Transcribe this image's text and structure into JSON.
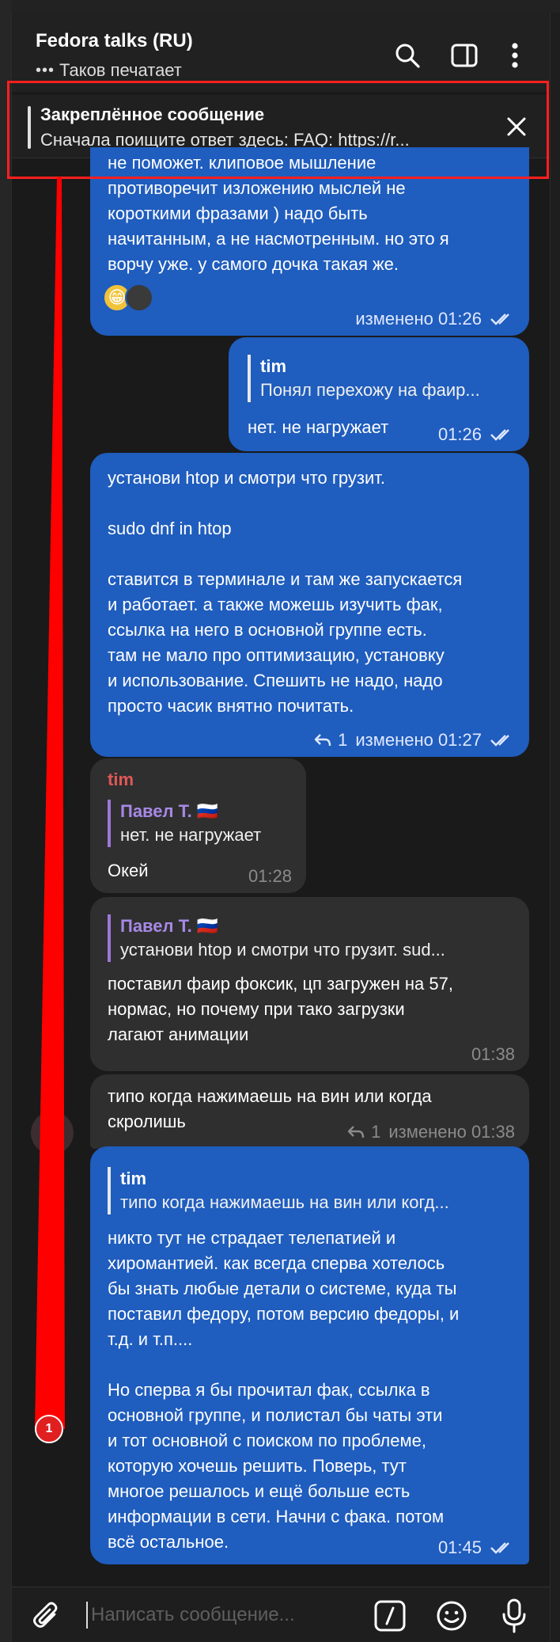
{
  "header": {
    "title": "Fedora talks (RU)",
    "status": "Таков печатает",
    "typing_indicator": "•••"
  },
  "pinned": {
    "title": "Закреплённое сообщение",
    "text": "Сначала поищите ответ здесь: FAQ: https://r..."
  },
  "messages": {
    "m1": {
      "text": "не поможет. клиповое мышление\nпротиворечит изложению мыслей не\nкороткими фразами ) надо быть\nначитанным, а не насмотренным. но это я\nворчу уже. у самого дочка такая же.",
      "reaction": "😁",
      "meta": "изменено 01:26"
    },
    "m2": {
      "quote_name": "tim",
      "quote_text": "Понял перехожу на фаир...",
      "text": "нет. не нагружает",
      "time": "01:26"
    },
    "m3": {
      "text": "установи htop и смотри что грузит.\n\nsudo dnf in htop\n\nставится в терминале и там же запускается\nи работает. а также можешь изучить фак,\nссылка на него в основной группе есть.\nтам не мало про оптимизацию, установку\nи использование. Спешить не надо, надо\nпросто часик внятно почитать.",
      "replies": "1",
      "meta": "изменено 01:27"
    },
    "m4": {
      "sender": "tim",
      "quote_name": "Павел Т. 🇷🇺",
      "quote_text": "нет. не нагружает",
      "text": "Окей",
      "time": "01:28"
    },
    "m5": {
      "quote_name": "Павел Т. 🇷🇺",
      "quote_text": "установи htop и смотри что грузит.  sud...",
      "text": "поставил фаир фоксик, цп загружен на 57,\nнормас, но почему при тако загрузки\nлагают анимации",
      "time": "01:38"
    },
    "m6": {
      "text": "типо когда нажимаешь на вин или когда\nскролишь",
      "replies": "1",
      "meta": "изменено 01:38"
    },
    "m7": {
      "quote_name": "tim",
      "quote_text": "типо когда нажимаешь на вин или когд...",
      "text": "никто тут не страдает телепатией и\nхиромантией. как всегда сперва хотелось\nбы знать любые детали о системе, куда ты\nпоставил федору, потом версию федоры, и\nт.д. и т.п....\n\nНо сперва я бы прочитал фак, ссылка в\nосновной группе, и полистал бы чаты эти\nи тот основной с поиском по проблеме,\nкоторую хочешь решить. Поверь, тут\nмногое решалось и ещё больше есть\nинформации в сети. Начни с фака. потом\nвсё остальное.",
      "time": "01:45"
    }
  },
  "unread_badge": "1",
  "composer": {
    "placeholder": "Написать сообщение..."
  },
  "colors": {
    "outgoing_bubble": "#1f5dbe",
    "incoming_bubble": "#2f2f2f",
    "annotation_red": "#ff1f1f",
    "quote_name_purple": "#a689e6",
    "sender_red": "#e05757"
  },
  "icons": [
    "search-icon",
    "sidebar-toggle-icon",
    "more-vertical-icon",
    "close-icon",
    "double-check-icon",
    "reply-icon",
    "attach-icon",
    "commands-icon",
    "emoji-icon",
    "microphone-icon"
  ]
}
